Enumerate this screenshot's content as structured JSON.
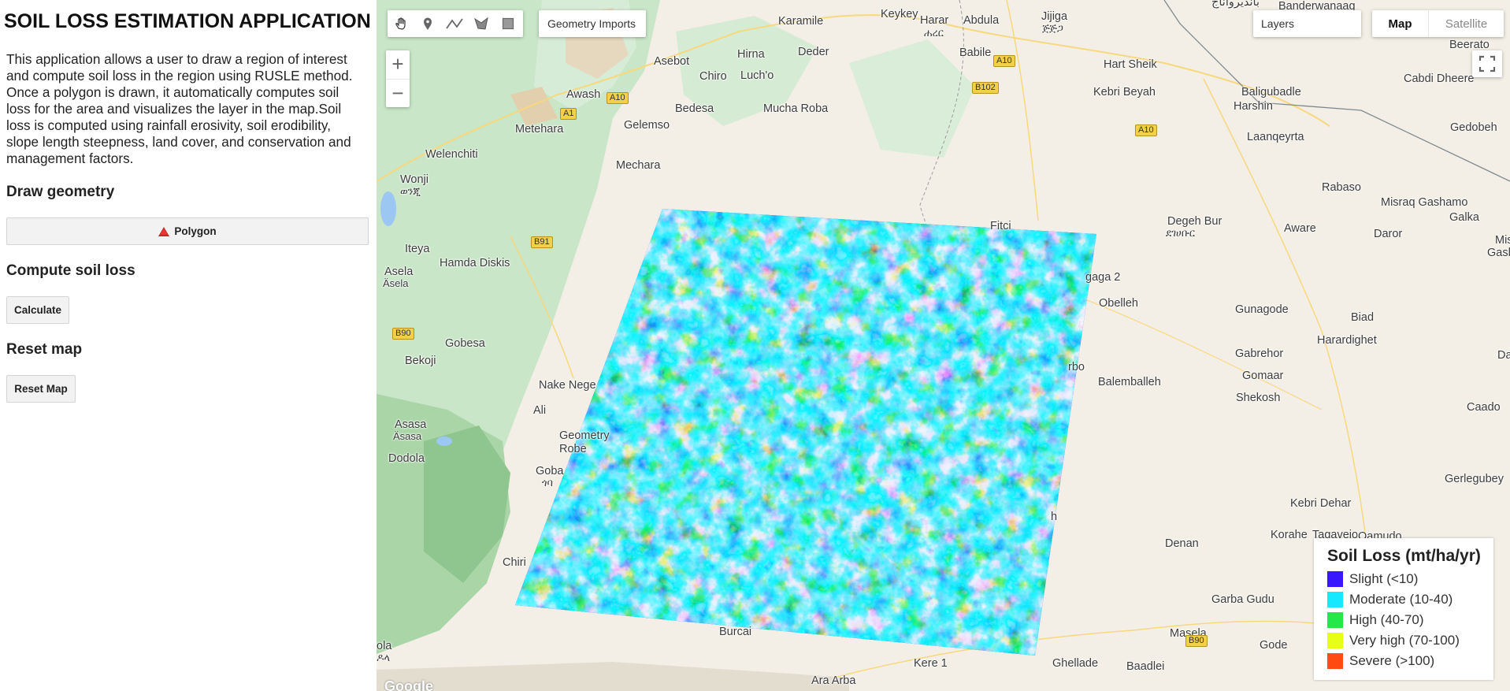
{
  "panel": {
    "title": "SOIL LOSS ESTIMATION APPLICATION",
    "description": "This application allows a user to draw a region of interest and compute soil loss in the region using RUSLE method. Once a polygon is drawn, it automatically computes soil loss for the area and visualizes the layer in the map.Soil loss is computed using rainfall erosivity, soil erodibility, slope length steepness, land cover, and conservation and management factors.",
    "draw_heading": "Draw geometry",
    "polygon_button": "Polygon",
    "compute_heading": "Compute soil loss",
    "calculate_button": "Calculate",
    "reset_heading": "Reset map",
    "reset_button": "Reset Map"
  },
  "map": {
    "geometry_imports": "Geometry Imports",
    "layers": "Layers",
    "map_type": "Map",
    "satellite_type": "Satellite",
    "zoom_in": "+",
    "zoom_out": "−",
    "tools": [
      "hand-icon",
      "marker-icon",
      "line-icon",
      "polygon-icon",
      "rectangle-icon"
    ],
    "google": "Google",
    "places": [
      "Keykey",
      "Harar",
      "ሐረር",
      "Jijiga",
      "ጅጅጋ",
      "Abdula",
      "Karamile",
      "Banderwanaag",
      "Beerato",
      "Asebot",
      "Hirna",
      "Deder",
      "Babile",
      "Hart Sheik",
      "Cabdi Dheere",
      "Chiro",
      "Luch'o",
      "Awash",
      "Kebri Beyah",
      "Baligubadle",
      "Harshin",
      "Metehara",
      "Bedesa",
      "Mucha Roba",
      "Laanqeyrta",
      "Gedobeh",
      "Gelemso",
      "Welenchiti",
      "Mechara",
      "Rabaso",
      "Wonji",
      "ወንጂ",
      "Misraq Gashamo",
      "Galka",
      "Fitci",
      "Degeh Bur",
      "ደገሀቡር",
      "Aware",
      "Daror",
      "Mis",
      "Gash",
      "Iteya",
      "Hamda Diskis",
      "gaga 2",
      "Asela",
      "Äsela",
      "Obelleh",
      "Gunagode",
      "Biad",
      "Gobesa",
      "Harardighet",
      "Bekoji",
      "Gabrehor",
      "Dan",
      "rbo",
      "Gomaar",
      "Nake Nege",
      "Balemballeh",
      "Shekosh",
      "Ali",
      "Caado",
      "Asasa",
      "Äsasa",
      "Geometry",
      "Robe",
      "Dodola",
      "Goba",
      "ጎባ",
      "Gerlegubey",
      "Kebri Dehar",
      "Korahe",
      "Tagaveio",
      "Qamudo",
      "h",
      "Chiri",
      "Denan",
      "Garba Gudu",
      "Burcai",
      "Masela",
      "Gode",
      "ola",
      "ዶላ",
      "Kere 1",
      "Ghellade",
      "Baadlei",
      "Ara Arba",
      "بانديرواناج"
    ],
    "roads": [
      "A10",
      "A10",
      "A1",
      "B102",
      "A10",
      "B91",
      "B90",
      "B90"
    ]
  },
  "legend": {
    "title": "Soil Loss (mt/ha/yr)",
    "items": [
      {
        "label": "Slight (<10)",
        "color": "#3a18ff"
      },
      {
        "label": "Moderate (10-40)",
        "color": "#16e8ff"
      },
      {
        "label": "High (40-70)",
        "color": "#22e84a"
      },
      {
        "label": "Very high (70-100)",
        "color": "#e6ff14"
      },
      {
        "label": "Severe (>100)",
        "color": "#ff4a12"
      }
    ]
  }
}
